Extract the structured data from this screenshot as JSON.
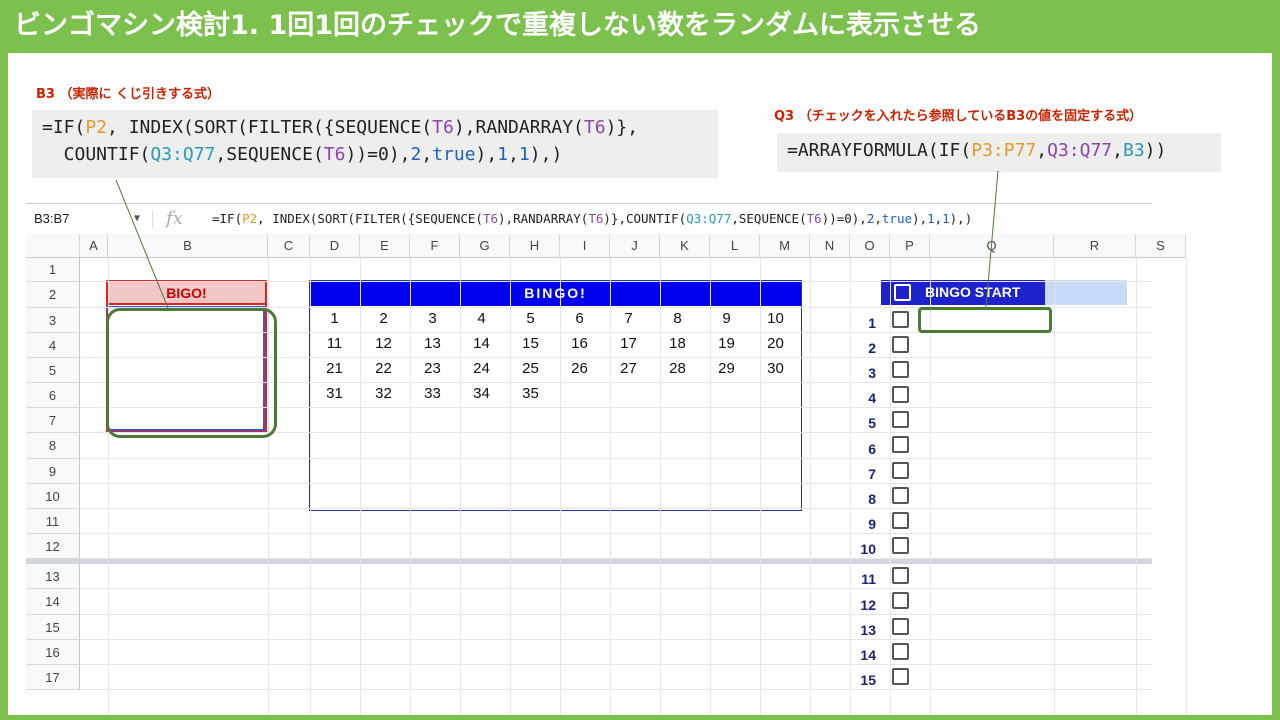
{
  "title": "ビンゴマシン検討1. 1回1回のチェックで重複しない数をランダムに表示させる",
  "notes": {
    "b3_label": "B3 （実際に くじ引きする式）",
    "q3_label": "Q3 （チェックを入れたら参照しているB3の値を固定する式）"
  },
  "code_b3": {
    "l1_a": "=IF(",
    "l1_b": "P2",
    "l1_c": ", INDEX(SORT(FILTER({SEQUENCE(",
    "l1_d": "T6",
    "l1_e": "),RANDARRAY(",
    "l1_f": "T6",
    "l1_g": ")},",
    "l2_a": "  COUNTIF(",
    "l2_b": "Q3:Q77",
    "l2_c": ",SEQUENCE(",
    "l2_d": "T6",
    "l2_e": "))=0),",
    "l2_f": "2",
    "l2_g": ",",
    "l2_h": "true",
    "l2_i": "),",
    "l2_j": "1",
    "l2_k": ",",
    "l2_l": "1",
    "l2_m": "),)"
  },
  "code_q3": {
    "a": "=ARRAYFORMULA(IF(",
    "b": "P3:P77",
    "c": ",",
    "d": "Q3:Q77",
    "e": ",",
    "f": "B3",
    "g": "))"
  },
  "formula_bar": {
    "cell_ref": "B3:B7",
    "caret": "▼",
    "fx": "fx",
    "f_a": "=IF(",
    "f_b": "P2",
    "f_c": ", INDEX(SORT(FILTER({SEQUENCE(",
    "f_d": "T6",
    "f_e": "),RANDARRAY(",
    "f_f": "T6",
    "f_g": ")},COUNTIF(",
    "f_h": "Q3:Q77",
    "f_i": ",SEQUENCE(",
    "f_j": "T6",
    "f_k": "))=0),",
    "f_l": "2",
    "f_m": ",",
    "f_n": "true",
    "f_o": "),",
    "f_p": "1",
    "f_q": ",",
    "f_r": "1",
    "f_s": "),)"
  },
  "columns": [
    "A",
    "B",
    "C",
    "D",
    "E",
    "F",
    "G",
    "H",
    "I",
    "J",
    "K",
    "L",
    "M",
    "N",
    "O",
    "P",
    "Q",
    "R",
    "S"
  ],
  "rows": [
    "1",
    "2",
    "3",
    "4",
    "5",
    "6",
    "7",
    "8",
    "9",
    "10",
    "11",
    "12",
    "13",
    "14",
    "15",
    "16",
    "17"
  ],
  "bigo_label": "BIGO!",
  "bingo_label": "BINGO!",
  "bingo_numbers": [
    "1",
    "2",
    "3",
    "4",
    "5",
    "6",
    "7",
    "8",
    "9",
    "10",
    "11",
    "12",
    "13",
    "14",
    "15",
    "16",
    "17",
    "18",
    "19",
    "20",
    "21",
    "22",
    "23",
    "24",
    "25",
    "26",
    "27",
    "28",
    "29",
    "30",
    "31",
    "32",
    "33",
    "34",
    "35"
  ],
  "bingo_start_label": "BINGO START",
  "checkbox_numbers": [
    "1",
    "2",
    "3",
    "4",
    "5",
    "6",
    "7",
    "8",
    "9",
    "10",
    "11",
    "12",
    "13",
    "14",
    "15"
  ],
  "colors": {
    "frame_green": "#7cc04e",
    "bingo_blue": "#0000ee",
    "bigo_red": "#dd2222",
    "annot_green": "#4a7a3a"
  }
}
